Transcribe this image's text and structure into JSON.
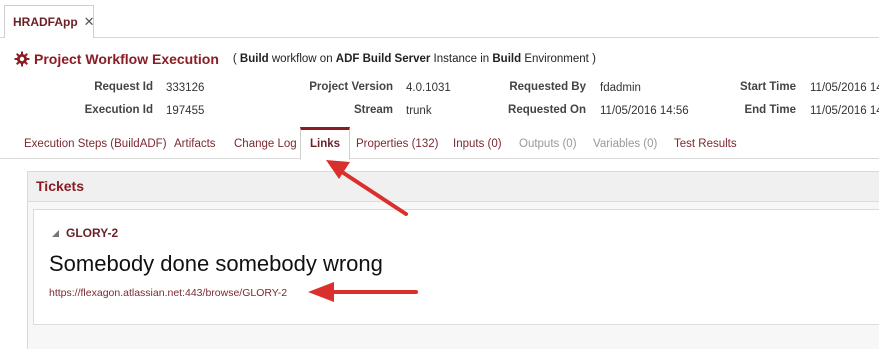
{
  "app_tab": {
    "label": "HRADFApp",
    "close_glyph": "✕"
  },
  "header": {
    "title": "Project Workflow Execution",
    "subtitle_parts": {
      "open": "( ",
      "build1": "Build",
      "t1": " workflow on ",
      "server": "ADF Build Server",
      "t2": " Instance in ",
      "build2": "Build",
      "t3": " Environment )"
    }
  },
  "info": {
    "request_id": {
      "label": "Request Id",
      "value": "333126"
    },
    "execution_id": {
      "label": "Execution Id",
      "value": "197455"
    },
    "project_version": {
      "label": "Project Version",
      "value": "4.0.1031"
    },
    "stream": {
      "label": "Stream",
      "value": "trunk"
    },
    "requested_by": {
      "label": "Requested By",
      "value": "fdadmin"
    },
    "requested_on": {
      "label": "Requested On",
      "value": "11/05/2016 14:56"
    },
    "start_time": {
      "label": "Start Time",
      "value": "11/05/2016 14"
    },
    "end_time": {
      "label": "End Time",
      "value": "11/05/2016 14"
    }
  },
  "tabs": [
    {
      "label": "Execution Steps (BuildADF)"
    },
    {
      "label": "Artifacts"
    },
    {
      "label": "Change Log"
    },
    {
      "label": "Links"
    },
    {
      "label": "Properties (132)"
    },
    {
      "label": "Inputs (0)"
    },
    {
      "label": "Outputs (0)"
    },
    {
      "label": "Variables (0)"
    },
    {
      "label": "Test Results"
    }
  ],
  "tickets": {
    "title": "Tickets",
    "items": [
      {
        "key": "GLORY-2",
        "summary": "Somebody done somebody wrong",
        "url": "https://flexagon.atlassian.net:443/browse/GLORY-2"
      }
    ]
  },
  "colors": {
    "accent": "#8a1c24",
    "annotation_arrow": "#d9302e"
  },
  "icons": {
    "gear": "gear-icon",
    "collapse": "collapse-triangle-icon"
  }
}
